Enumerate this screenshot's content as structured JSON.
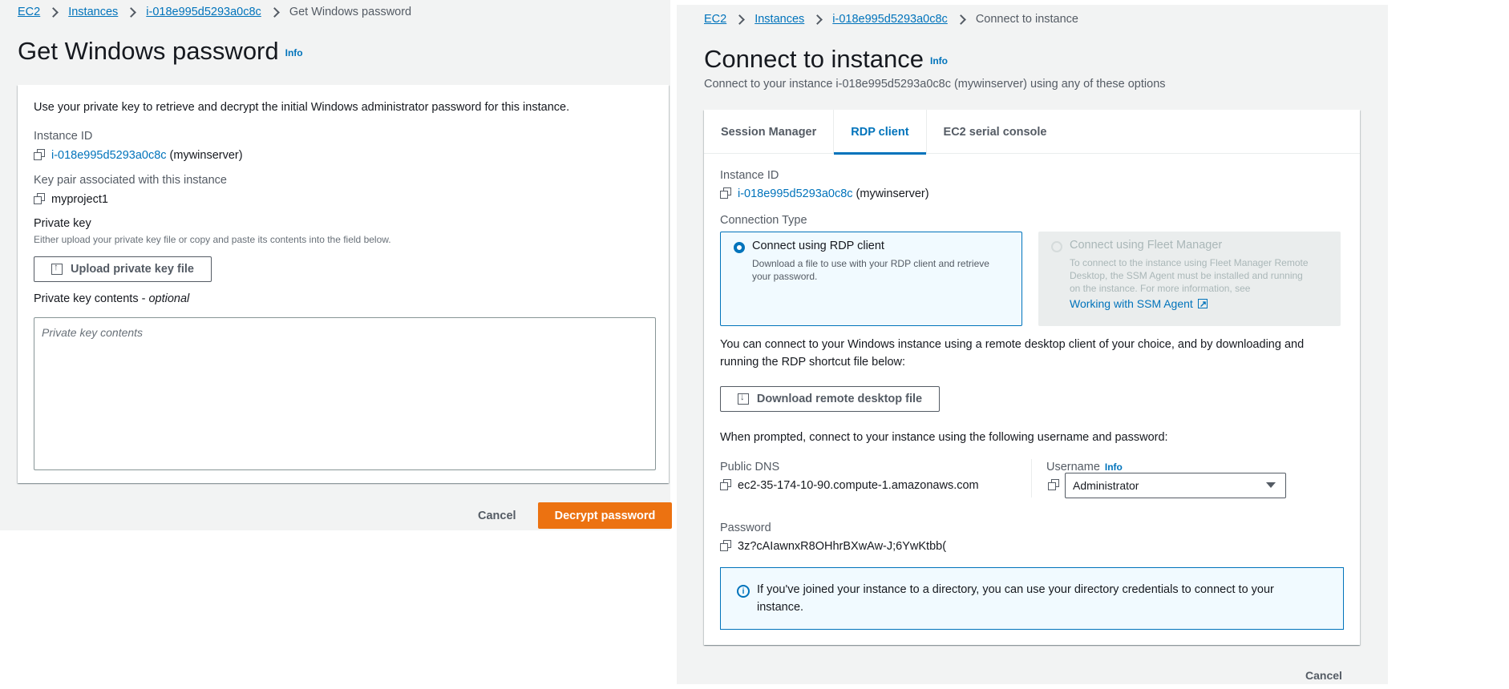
{
  "left": {
    "breadcrumb": [
      "EC2",
      "Instances",
      "i-018e995d5293a0c8c",
      "Get Windows password"
    ],
    "title": "Get Windows password",
    "info_link": "Info",
    "description": "Use your private key to retrieve and decrypt the initial Windows administrator password for this instance.",
    "instance_id_label": "Instance ID",
    "instance_id": "i-018e995d5293a0c8c",
    "instance_name": "(mywinserver)",
    "key_pair_label": "Key pair associated with this instance",
    "key_pair": "myproject1",
    "private_key_label": "Private key",
    "private_key_hint": "Either upload your private key file or copy and paste its contents into the field below.",
    "upload_button": "Upload private key file",
    "contents_label": "Private key contents - ",
    "contents_optional": "optional",
    "contents_placeholder": "Private key contents",
    "cancel": "Cancel",
    "decrypt": "Decrypt password"
  },
  "right": {
    "breadcrumb": [
      "EC2",
      "Instances",
      "i-018e995d5293a0c8c",
      "Connect to instance"
    ],
    "title": "Connect to instance",
    "info_link": "Info",
    "subtitle": "Connect to your instance i-018e995d5293a0c8c (mywinserver) using any of these options",
    "tabs": [
      "Session Manager",
      "RDP client",
      "EC2 serial console"
    ],
    "active_tab": "RDP client",
    "instance_id_label": "Instance ID",
    "instance_id": "i-018e995d5293a0c8c",
    "instance_name": "(mywinserver)",
    "connection_type_label": "Connection Type",
    "option_rdp": {
      "title": "Connect using RDP client",
      "desc": "Download a file to use with your RDP client and retrieve your password."
    },
    "option_fleet": {
      "title": "Connect using Fleet Manager",
      "desc": "To connect to the instance using Fleet Manager Remote Desktop, the SSM Agent must be installed and running on the instance. For more information, see",
      "link": "Working with SSM Agent"
    },
    "rdp_text": "You can connect to your Windows instance using a remote desktop client of your choice, and by downloading and running the RDP shortcut file below:",
    "download_button": "Download remote desktop file",
    "prompt_text": "When prompted, connect to your instance using the following username and password:",
    "public_dns_label": "Public DNS",
    "public_dns": "ec2-35-174-10-90.compute-1.amazonaws.com",
    "username_label": "Username",
    "username_info": "Info",
    "username_value": "Administrator",
    "password_label": "Password",
    "password_value": "3z?cAIawnxR8OHhrBXwAw-J;6YwKtbb(",
    "alert_text": "If you've joined your instance to a directory, you can use your directory credentials to connect to your instance.",
    "cancel": "Cancel"
  }
}
